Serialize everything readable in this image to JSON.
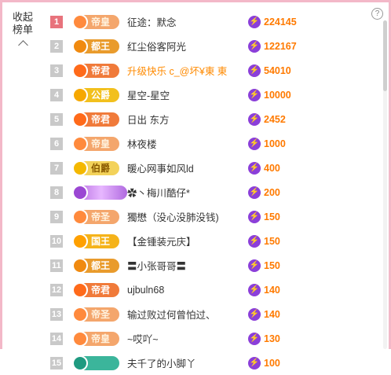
{
  "panel": {
    "collapse_label_1": "收起",
    "collapse_label_2": "榜单",
    "help_icon": "?"
  },
  "rows": [
    {
      "rank": "1",
      "badge": "帝皇",
      "name": "征途：默念",
      "score": "224145"
    },
    {
      "rank": "2",
      "badge": "都王",
      "name": "红尘俗客阿光",
      "score": "122167"
    },
    {
      "rank": "3",
      "badge": "帝君",
      "name": "升级快乐 c_@坏¥東 東",
      "score": "54010"
    },
    {
      "rank": "4",
      "badge": "公爵",
      "name": "星空-星空",
      "score": "10000"
    },
    {
      "rank": "5",
      "badge": "帝君",
      "name": "日出 东方",
      "score": "2452"
    },
    {
      "rank": "6",
      "badge": "帝皇",
      "name": "林夜楼",
      "score": "1000"
    },
    {
      "rank": "7",
      "badge": "伯爵",
      "name": "暖心网事如风ld",
      "score": "400"
    },
    {
      "rank": "8",
      "badge": "",
      "name": "✿丶梅川酷仔*",
      "score": "200"
    },
    {
      "rank": "9",
      "badge": "帝圣",
      "name": "獨懋（没心没肺没钱)",
      "score": "150"
    },
    {
      "rank": "10",
      "badge": "国王",
      "name": "【金锺装元庆】",
      "score": "150"
    },
    {
      "rank": "11",
      "badge": "都王",
      "name": "〓小张哥哥〓",
      "score": "150"
    },
    {
      "rank": "12",
      "badge": "帝君",
      "name": "ujbuln68",
      "score": "140"
    },
    {
      "rank": "13",
      "badge": "帝圣",
      "name": "输过败过何曾怕过、",
      "score": "140"
    },
    {
      "rank": "14",
      "badge": "帝皇",
      "name": "~哎吖~",
      "score": "130"
    },
    {
      "rank": "15",
      "badge": "",
      "name": "夫千了的小脚丫",
      "score": "100"
    }
  ]
}
